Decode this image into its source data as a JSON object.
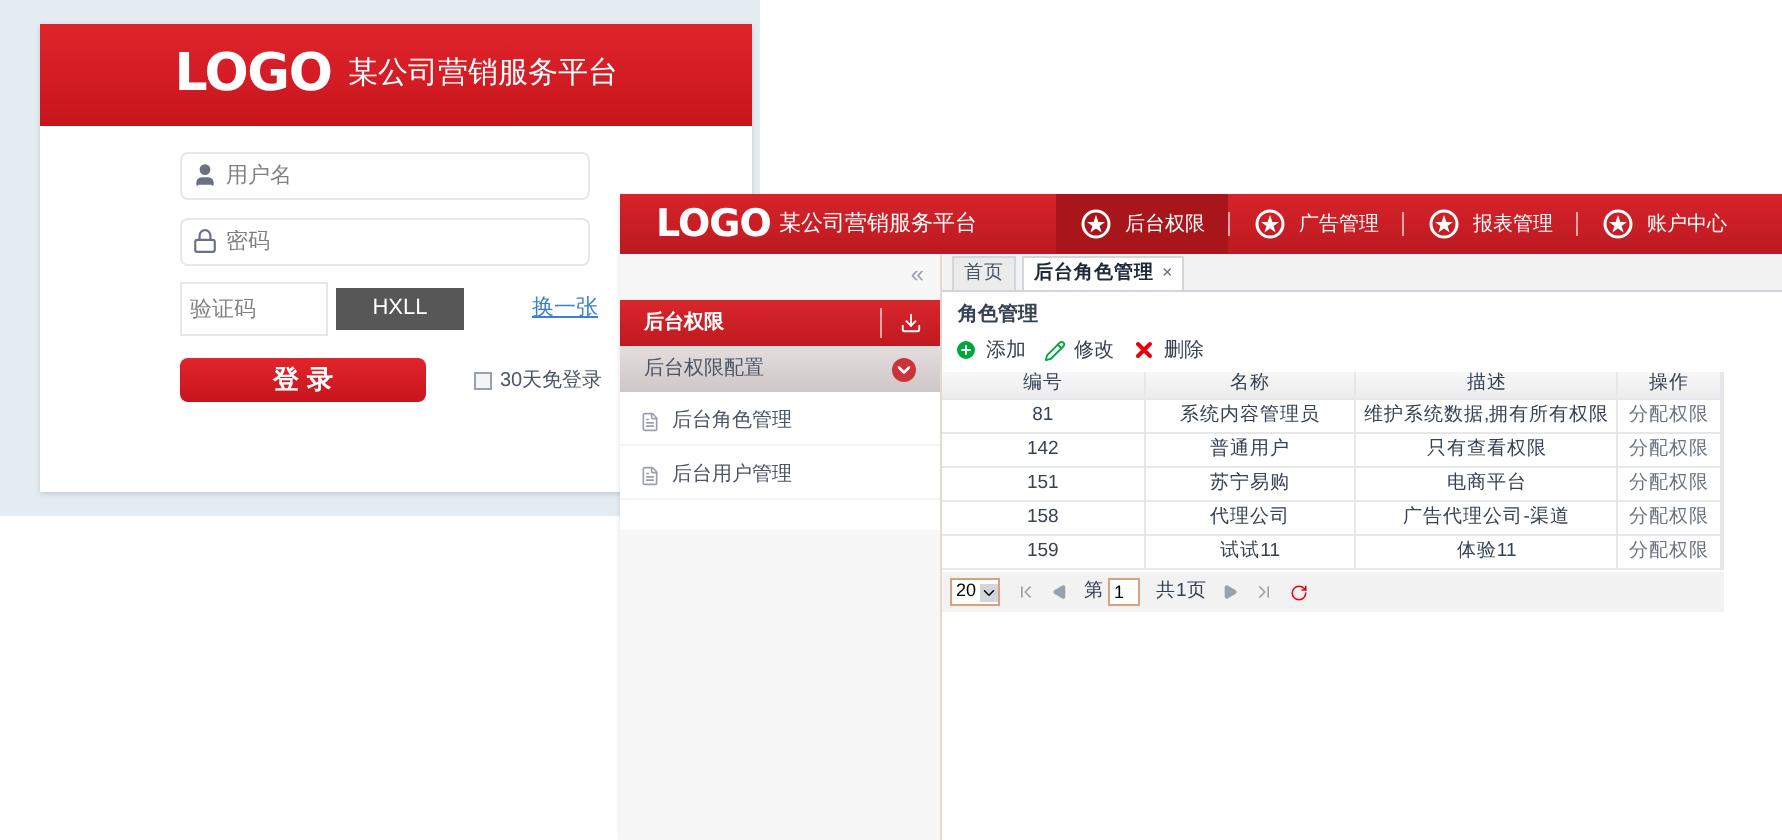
{
  "login": {
    "logo": "LOGO",
    "title": "某公司营销服务平台",
    "fields": [
      {
        "kind": "user",
        "placeholder": "用户名"
      },
      {
        "kind": "lock",
        "placeholder": "密码"
      }
    ],
    "captcha": {
      "placeholder": "验证码",
      "code": "HXLL",
      "refresh": "换一张"
    },
    "submit": "登 录",
    "remember": {
      "label": "30天免登录",
      "checked": false
    }
  },
  "admin": {
    "logo": "LOGO",
    "title": "某公司营销服务平台",
    "nav": [
      {
        "label": "后台权限",
        "selected": true
      },
      {
        "label": "广告管理",
        "selected": false
      },
      {
        "label": "报表管理",
        "selected": false
      },
      {
        "label": "账户中心",
        "selected": false
      }
    ],
    "collapse": "«",
    "tabs": [
      {
        "label": "首页",
        "selected": false
      },
      {
        "label": "后台角色管理",
        "selected": true,
        "close": "×"
      }
    ],
    "sidebar": {
      "section": "后台权限",
      "groups": [
        {
          "label": "后台权限配置",
          "expanded": true,
          "children": [
            {
              "label": "后台角色管理"
            },
            {
              "label": "后台用户管理"
            }
          ]
        }
      ]
    },
    "panel": {
      "title": "角色管理",
      "toolbar": [
        {
          "kind": "add",
          "label": "添加"
        },
        {
          "kind": "edit",
          "label": "修改"
        },
        {
          "kind": "delete",
          "label": "删除"
        }
      ],
      "table": {
        "columns": [
          "编号",
          "名称",
          "描述",
          "操作"
        ],
        "rows": [
          [
            "81",
            "系统内容管理员",
            "维护系统数据,拥有所有权限",
            "分配权限"
          ],
          [
            "142",
            "普通用户",
            "只有查看权限",
            "分配权限"
          ],
          [
            "151",
            "苏宁易购",
            "电商平台",
            "分配权限"
          ],
          [
            "158",
            "代理公司",
            "广告代理公司-渠道",
            "分配权限"
          ],
          [
            "159",
            "试试11",
            "体验11",
            "分配权限"
          ]
        ]
      },
      "pager": {
        "page_size": "20",
        "page_label": "第",
        "page": "1",
        "total": "共1页"
      }
    }
  }
}
